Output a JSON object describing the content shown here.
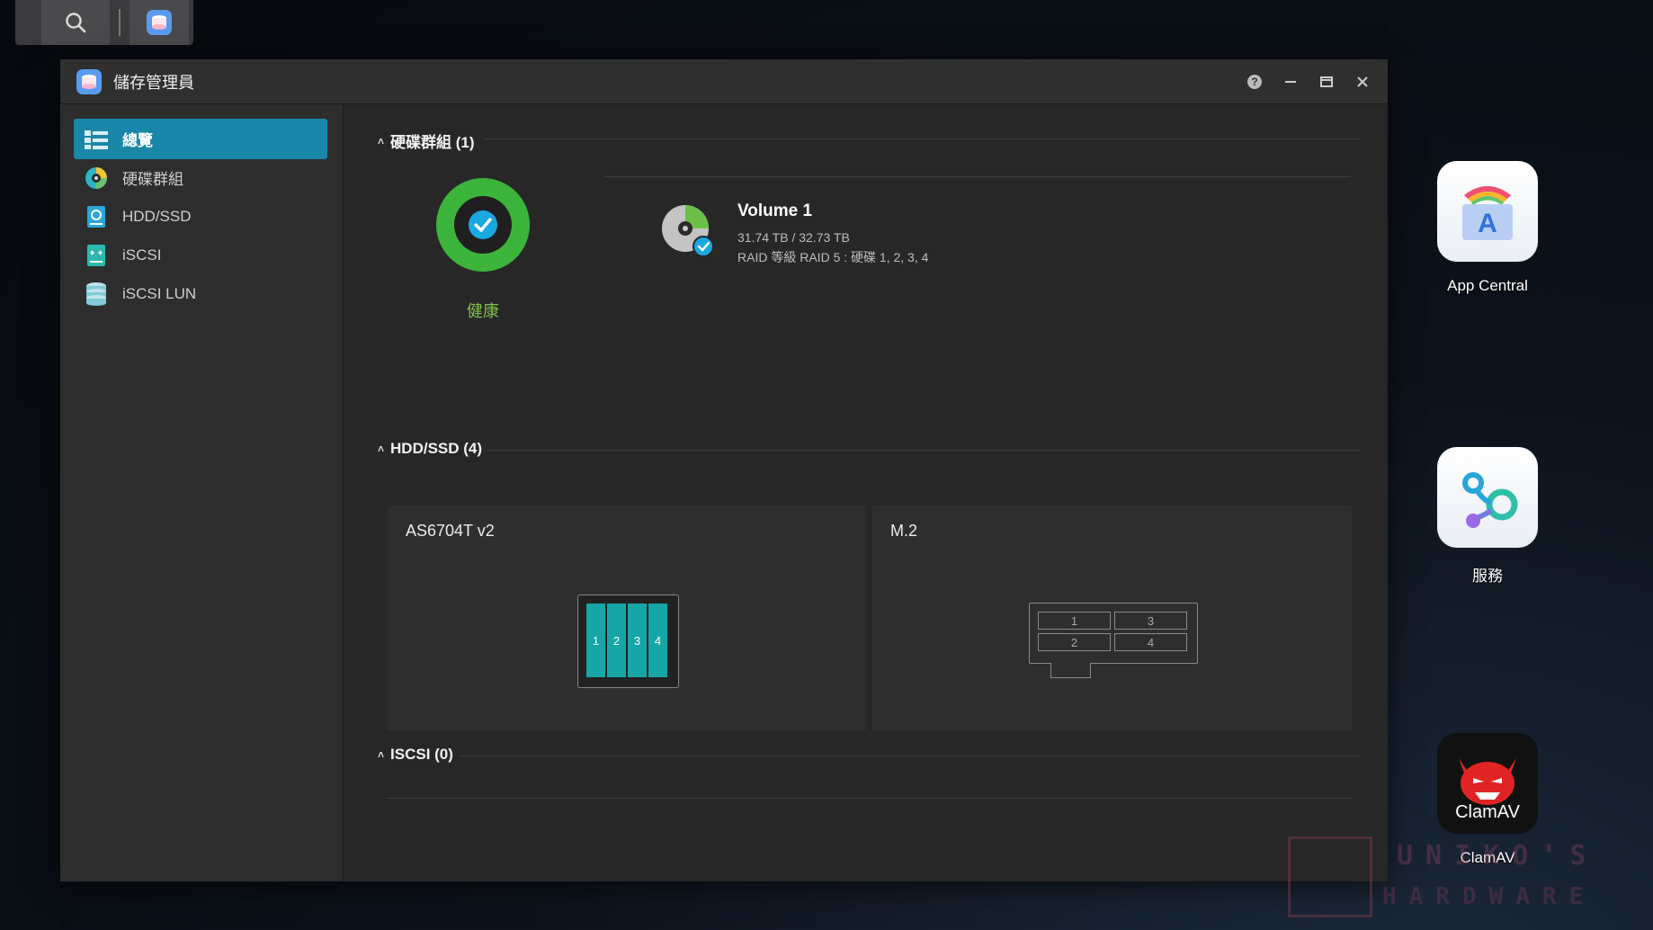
{
  "window": {
    "title": "儲存管理員"
  },
  "sidebar": {
    "items": [
      {
        "label": "總覽",
        "icon": "overview-icon",
        "active": true
      },
      {
        "label": "硬碟群組",
        "icon": "volume-icon",
        "active": false
      },
      {
        "label": "HDD/SSD",
        "icon": "disk-icon",
        "active": false
      },
      {
        "label": "iSCSI",
        "icon": "iscsi-icon",
        "active": false
      },
      {
        "label": "iSCSI LUN",
        "icon": "iscsi-lun-icon",
        "active": false
      }
    ]
  },
  "volumes_section": {
    "heading": "硬碟群組 (1)"
  },
  "health": {
    "status": "健康",
    "color": "#3cb43c"
  },
  "volume": {
    "name": "Volume 1",
    "capacity": "31.74 TB / 32.73 TB",
    "raid": "RAID 等級 RAID 5 : 硬碟 1, 2, 3, 4"
  },
  "disks_section": {
    "heading": "HDD/SSD (4)"
  },
  "enclosures": [
    {
      "name": "AS6704T v2",
      "bays": [
        "1",
        "2",
        "3",
        "4"
      ]
    },
    {
      "name": "M.2",
      "slots": [
        "1",
        "3",
        "2",
        "4"
      ]
    }
  ],
  "iscsi_section": {
    "heading": "ISCSI (0)"
  },
  "desktop": [
    {
      "label": "App Central",
      "icon": "app-central-icon"
    },
    {
      "label": "服務",
      "icon": "services-icon"
    },
    {
      "label": "ClamAV",
      "icon": "clamav-icon"
    }
  ],
  "watermark": {
    "line1": "UNIKO'S",
    "line2": "HARDWARE"
  },
  "colors": {
    "accent": "#1b87a8",
    "bay": "#16a6a6",
    "healthy": "#7dc14a"
  }
}
